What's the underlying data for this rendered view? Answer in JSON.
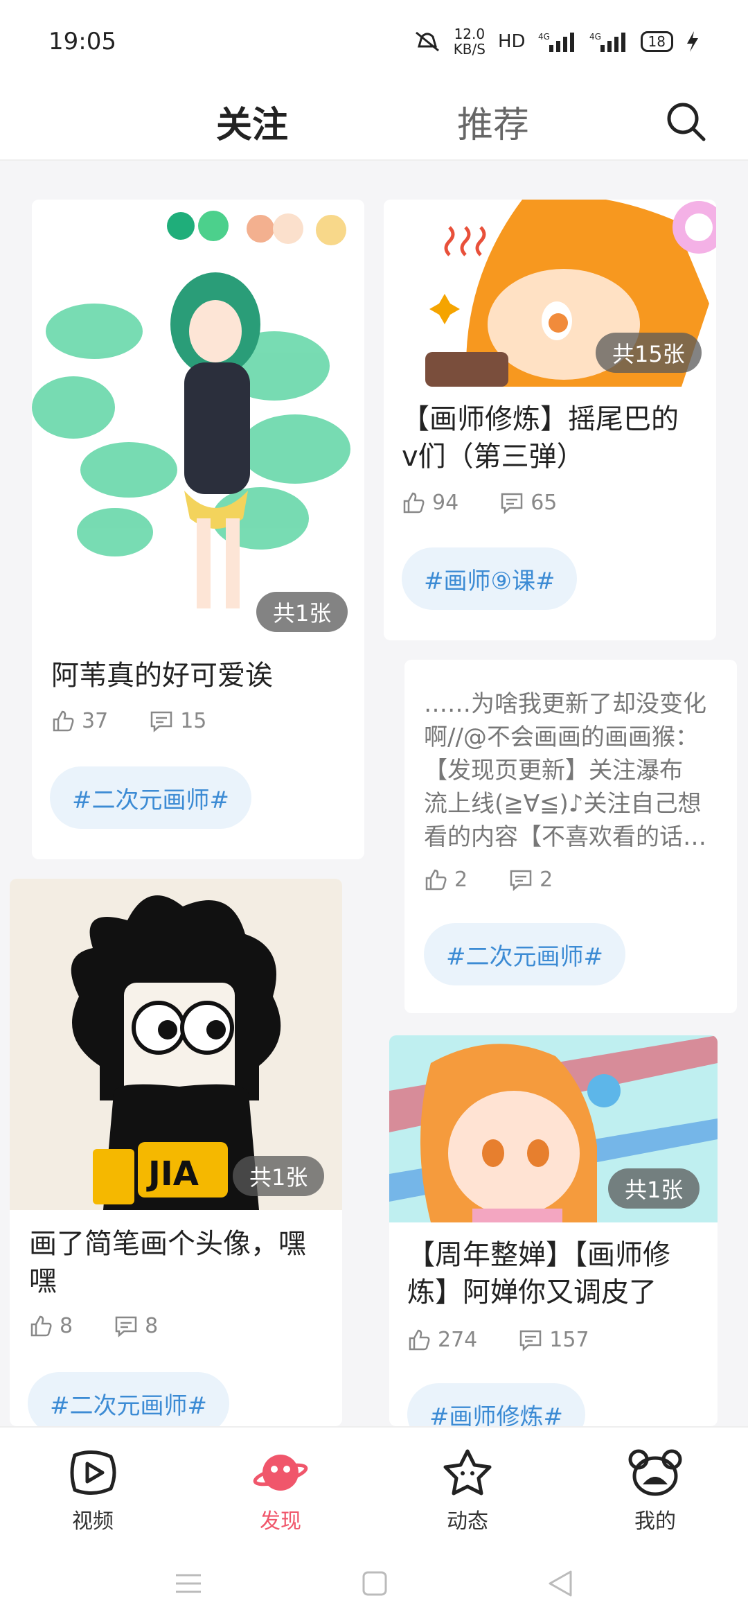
{
  "status": {
    "time": "19:05",
    "net_speed_value": "12.0",
    "net_speed_unit": "KB/S",
    "hd": "HD",
    "battery": "18"
  },
  "top_tabs": {
    "follow": "关注",
    "recommend": "推荐"
  },
  "cards": {
    "c1": {
      "badge": "共1张",
      "title": "阿苇真的好可爱诶",
      "likes": "37",
      "comments": "15",
      "tag": "#二次元画师#"
    },
    "c2": {
      "badge": "共15张",
      "title_line1": "【画师修炼】摇尾巴的",
      "title_line2": "v们（第三弹）",
      "likes": "94",
      "comments": "65",
      "tag": "#画师⑨课#"
    },
    "c3": {
      "desc1": "……为啥我更新了却没变化",
      "desc2": "啊//@不会画画的画画猴：",
      "desc3": "【发现页更新】关注瀑布",
      "desc4": "流上线(≧∀≦)♪关注自己想",
      "desc5": "看的内容【不喜欢看的话…",
      "likes": "2",
      "comments": "2",
      "tag": "#二次元画师#"
    },
    "c4": {
      "badge": "共1张",
      "title_line1": "画了简笔画个头像，嘿",
      "title_line2": "嘿",
      "likes": "8",
      "comments": "8",
      "tag": "#二次元画师#"
    },
    "c5": {
      "badge": "共1张",
      "title_line1": "【周年整婵】【画师修",
      "title_line2": "炼】阿婵你又调皮了",
      "likes": "274",
      "comments": "157",
      "tag": "#画师修炼#"
    }
  },
  "bottom_nav": {
    "video": "视频",
    "discover": "发现",
    "dynamic": "动态",
    "mine": "我的"
  },
  "colors": {
    "accent": "#f0566b",
    "tag_text": "#3c8bd4",
    "tag_bg": "#eaf3fb"
  },
  "icons": [
    "mute-icon",
    "signal-icon",
    "battery-icon",
    "charging-icon",
    "search-icon",
    "like-icon",
    "comment-icon",
    "video-icon",
    "discover-icon",
    "dynamic-icon",
    "mine-icon",
    "menu-icon",
    "home-icon",
    "back-icon"
  ]
}
